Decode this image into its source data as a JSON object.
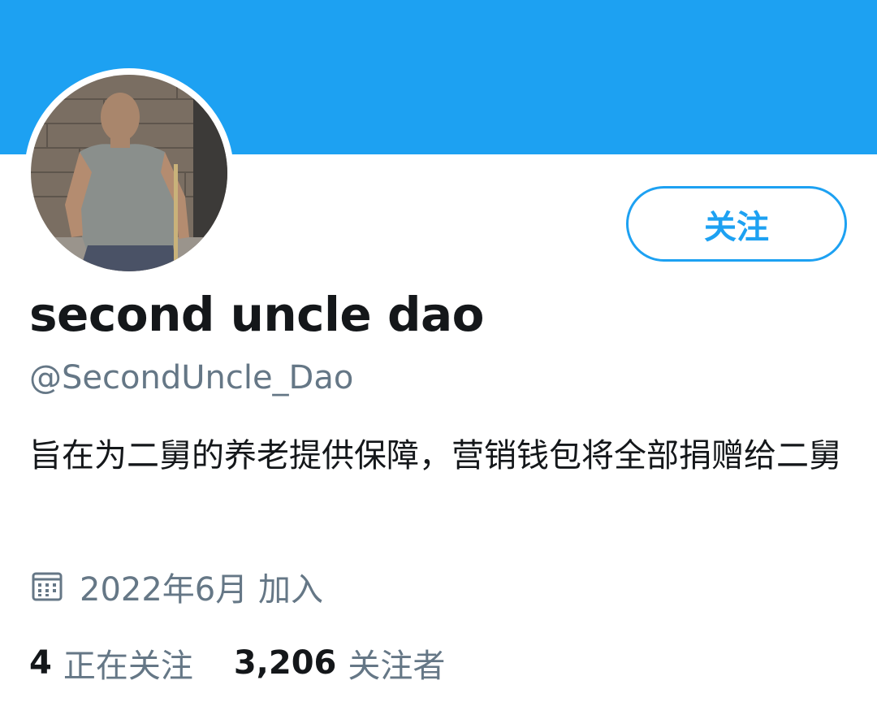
{
  "profile": {
    "display_name": "second uncle dao",
    "handle": "@SecondUncle_Dao",
    "bio": "旨在为二舅的养老提供保障，营销钱包将全部捐赠给二舅",
    "joined": "2022年6月 加入",
    "follow_label": "关注",
    "avatar_icon": "profile-photo"
  },
  "stats": {
    "following_count": "4",
    "following_label": "正在关注",
    "followers_count": "3,206",
    "followers_label": "关注者"
  },
  "colors": {
    "banner": "#1da1f2",
    "accent": "#1da1f2",
    "text_primary": "#14171a",
    "text_secondary": "#657786"
  }
}
